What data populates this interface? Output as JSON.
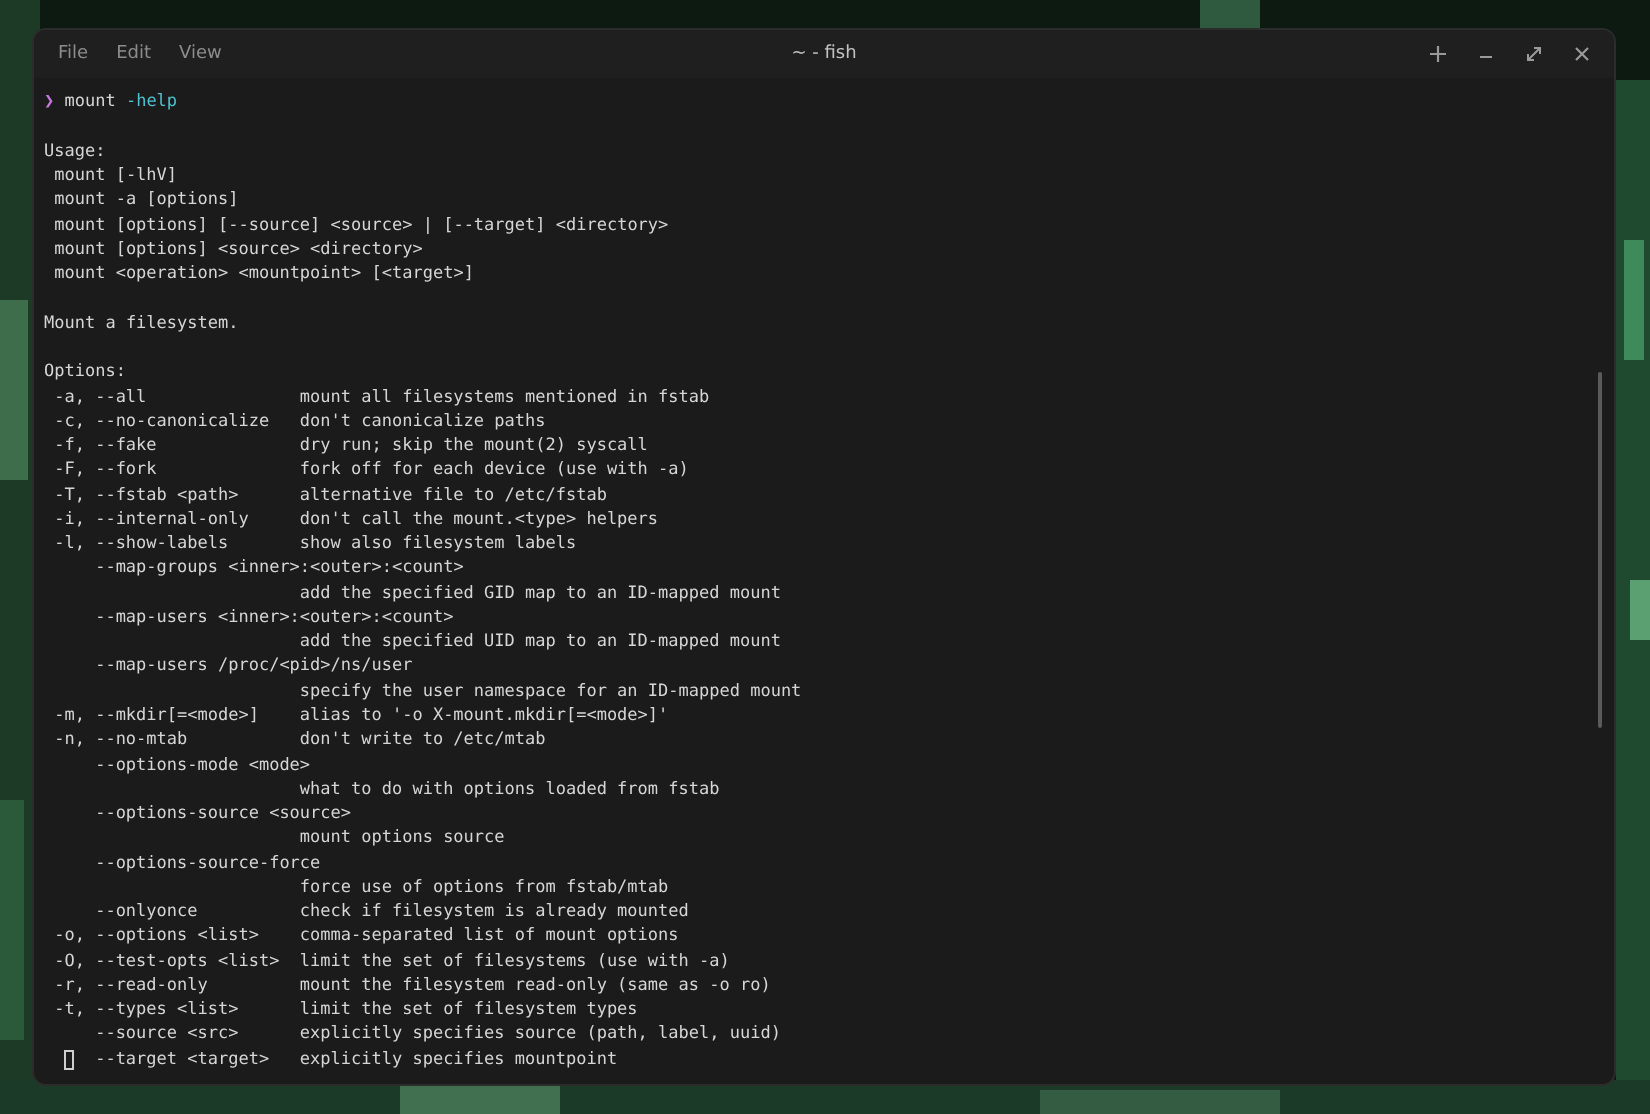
{
  "window": {
    "menu": [
      "File",
      "Edit",
      "View"
    ],
    "title": "~ - fish",
    "controls": [
      {
        "kind": "new"
      },
      {
        "kind": "minimize"
      },
      {
        "kind": "maximize"
      },
      {
        "kind": "close"
      }
    ]
  },
  "terminal": {
    "prompt": {
      "symbol": "❯",
      "command": "mount",
      "argument": "-help"
    },
    "usage_title": "Usage:",
    "usage": [
      " mount [-lhV]",
      " mount -a [options]",
      " mount [options] [--source] <source> | [--target] <directory>",
      " mount [options] <source> <directory>",
      " mount <operation> <mountpoint> [<target>]"
    ],
    "summary": "Mount a filesystem.",
    "options_title": "Options:",
    "options": [
      {
        "flag": "-a, --all",
        "desc": "mount all filesystems mentioned in fstab"
      },
      {
        "flag": "-c, --no-canonicalize",
        "desc": "don't canonicalize paths"
      },
      {
        "flag": "-f, --fake",
        "desc": "dry run; skip the mount(2) syscall"
      },
      {
        "flag": "-F, --fork",
        "desc": "fork off for each device (use with -a)"
      },
      {
        "flag": "-T, --fstab <path>",
        "desc": "alternative file to /etc/fstab"
      },
      {
        "flag": "-i, --internal-only",
        "desc": "don't call the mount.<type> helpers"
      },
      {
        "flag": "-l, --show-labels",
        "desc": "show also filesystem labels"
      },
      {
        "flag": "--map-groups <inner>:<outer>:<count>",
        "kind": "long"
      },
      {
        "desc": "add the specified GID map to an ID-mapped mount"
      },
      {
        "flag": "--map-users <inner>:<outer>:<count>",
        "kind": "long"
      },
      {
        "desc": "add the specified UID map to an ID-mapped mount"
      },
      {
        "flag": "--map-users /proc/<pid>/ns/user",
        "kind": "long"
      },
      {
        "desc": "specify the user namespace for an ID-mapped mount"
      },
      {
        "flag": "-m, --mkdir[=<mode>]",
        "desc": "alias to '-o X-mount.mkdir[=<mode>]'"
      },
      {
        "flag": "-n, --no-mtab",
        "desc": "don't write to /etc/mtab"
      },
      {
        "flag": "--options-mode <mode>",
        "kind": "long"
      },
      {
        "desc": "what to do with options loaded from fstab"
      },
      {
        "flag": "--options-source <source>",
        "kind": "long"
      },
      {
        "desc": "mount options source"
      },
      {
        "flag": "--options-source-force",
        "kind": "long"
      },
      {
        "desc": "force use of options from fstab/mtab"
      },
      {
        "flag": "--onlyonce",
        "kind": "long",
        "desc": "check if filesystem is already mounted"
      },
      {
        "flag": "-o, --options <list>",
        "desc": "comma-separated list of mount options"
      },
      {
        "flag": "-O, --test-opts <list>",
        "desc": "limit the set of filesystems (use with -a)"
      },
      {
        "flag": "-r, --read-only",
        "desc": "mount the filesystem read-only (same as -o ro)"
      },
      {
        "flag": "-t, --types <list>",
        "desc": "limit the set of filesystem types"
      },
      {
        "flag": "--source <src>",
        "kind": "long",
        "desc": "explicitly specifies source (path, label, uuid)"
      },
      {
        "flag": "--target <target>",
        "kind": "long",
        "desc": "explicitly specifies mountpoint",
        "cursor": true
      }
    ]
  }
}
